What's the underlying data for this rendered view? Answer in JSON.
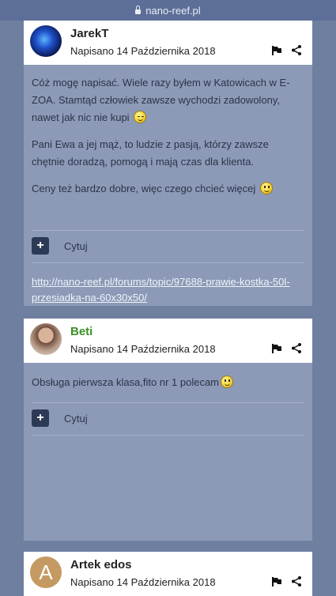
{
  "browser": {
    "url": "nano-reef.pl"
  },
  "posts": [
    {
      "author": "JarekT",
      "date": "Napisano 14 Października 2018",
      "paragraphs": [
        "Cóż mogę napisać. Wiele razy byłem w Katowicach  w E-ZOA. Stamtąd człowiek zawsze wychodzi zadowolony, nawet jak nic nie kupi",
        "Pani Ewa a jej mąż, to ludzie z pasją, którzy zawsze chętnie doradzą, pomogą i mają czas dla klienta.",
        "Ceny też bardzo dobre, więc czego chcieć więcej"
      ],
      "quote_label": "Cytuj",
      "link": "http://nano-reef.pl/forums/topic/97688-prawie-kostka-50l-przesiadka-na-60x30x50/"
    },
    {
      "author": "Beti",
      "date": "Napisano 14 Października 2018",
      "paragraphs": [
        "Obsługa pierwsza klasa,fito nr 1 polecam"
      ],
      "quote_label": "Cytuj"
    },
    {
      "author": "Artek edos",
      "avatar_letter": "A",
      "date": "Napisano 14 Października 2018"
    }
  ],
  "colors": {
    "accent_green": "#3a8f23",
    "post_body": "#8c9ab7",
    "page_bg": "#6f7fa0"
  }
}
